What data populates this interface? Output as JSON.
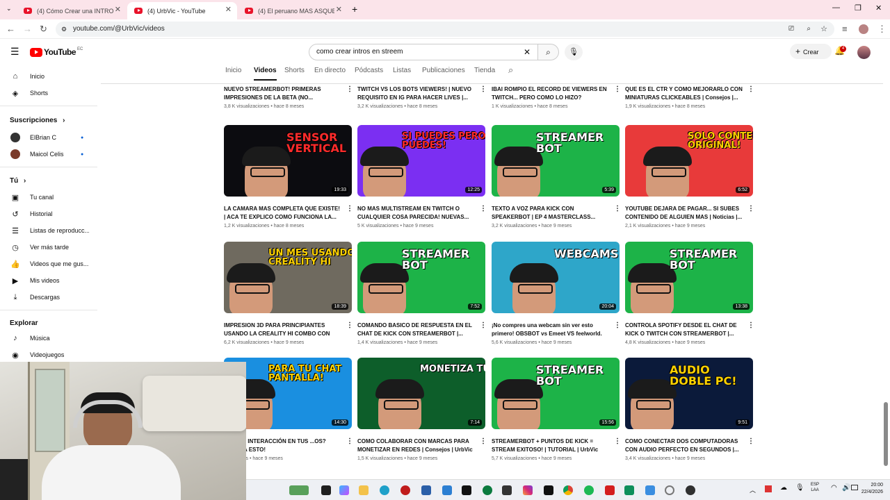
{
  "browser": {
    "tabs": [
      {
        "title": "(4) Cómo Crear una INTRO Pro..."
      },
      {
        "title": "(4) UrbVic - YouTube"
      },
      {
        "title": "(4) El peruano MAS ASQUEROS..."
      }
    ],
    "url": "youtube.com/@UrbVic/videos"
  },
  "yt": {
    "logo_text": "YouTube",
    "region": "EC",
    "search_value": "como crear intros en streem",
    "create_label": "Crear",
    "notif_count": "4"
  },
  "sidebar": {
    "items": [
      {
        "label": "Inicio",
        "icon": "home-icon"
      },
      {
        "label": "Shorts",
        "icon": "shorts-icon"
      }
    ],
    "subs_heading": "Suscripciones",
    "subs": [
      {
        "label": "ElBrian C"
      },
      {
        "label": "Maicol Celis"
      }
    ],
    "you_heading": "Tú",
    "you_items": [
      {
        "label": "Tu canal",
        "icon": "user-icon"
      },
      {
        "label": "Historial",
        "icon": "history-icon"
      },
      {
        "label": "Listas de reproducc...",
        "icon": "playlist-icon"
      },
      {
        "label": "Ver más tarde",
        "icon": "clock-icon"
      },
      {
        "label": "Videos que me gus...",
        "icon": "thumbs-up-icon"
      },
      {
        "label": "Mis videos",
        "icon": "video-icon"
      },
      {
        "label": "Descargas",
        "icon": "download-icon"
      }
    ],
    "explore_heading": "Explorar",
    "explore_items": [
      {
        "label": "Música",
        "icon": "music-icon"
      },
      {
        "label": "Videojuegos",
        "icon": "gamepad-icon"
      }
    ]
  },
  "channel_tabs": [
    "Inicio",
    "Videos",
    "Shorts",
    "En directo",
    "Pódcasts",
    "Listas",
    "Publicaciones",
    "Tienda"
  ],
  "prev_row": [
    {
      "title": "NUEVO STREAMERBOT! PRIMERAS IMPRESIONES DE LA BETA (NO...",
      "meta": "3,8 K visualizaciones  •  hace 8 meses"
    },
    {
      "title": "TWITCH VS LOS BOTS VIEWERS! | NUEVO REQUISITO EN IG PARA HACER LIVES |...",
      "meta": "3,2 K visualizaciones  •  hace 8 meses"
    },
    {
      "title": "IBAI ROMPIO EL RECORD DE VIEWERS EN TWITCH... PERO COMO LO HIZO? CREAND...",
      "meta": "1 K visualizaciones  •  hace 8 meses"
    },
    {
      "title": "QUE ES EL CTR Y COMO MEJORARLO CON MINIATURAS CLICKEABLES | Consejos |...",
      "meta": "1,9 K visualizaciones  •  hace 8 meses"
    }
  ],
  "videos": [
    {
      "thumb_text": "SENSOR VERTICAL",
      "bg": "#0c0c10",
      "accent": "#ff2b2b",
      "duration": "19:33",
      "title": "LA CAMARA MAS COMPLETA QUE EXISTE! | ACA TE EXPLICO COMO FUNCIONA LA...",
      "meta": "1,2 K visualizaciones  •  hace 8 meses"
    },
    {
      "thumb_text": "SI PUEDES PERO NO PUEDES!",
      "bg": "#7b2ff2",
      "accent": "#ff2b2b",
      "duration": "12:25",
      "title": "NO MAS MULTISTREAM EN TWITCH O CUALQUIER COSA PARECIDA! NUEVAS...",
      "meta": "5 K visualizaciones  •  hace 9 meses"
    },
    {
      "thumb_text": "STREAMER BOT",
      "bg": "#1db348",
      "accent": "#000000",
      "duration": "5:39",
      "title": "TEXTO A VOZ PARA KICK CON SPEAKERBOT | EP 4 MASTERCLASS...",
      "meta": "3,2 K visualizaciones  •  hace 9 meses"
    },
    {
      "thumb_text": "SOLO CONTENIDO ORIGINAL!",
      "bg": "#e83a3a",
      "accent": "#ffd200",
      "duration": "6:52",
      "title": "YOUTUBE DEJARA DE PAGAR... SI SUBES CONTENIDO DE ALGUIEN MAS | Noticias |...",
      "meta": "2,1 K visualizaciones  •  hace 9 meses"
    },
    {
      "thumb_text": "UN MES USANDO LA CREALITY HI",
      "bg": "#6f6a5f",
      "accent": "#ffd200",
      "duration": "18:39",
      "title": "IMPRESION 3D PARA PRINCIPIANTES USANDO LA CREALITY HI COMBO CON CF...",
      "meta": "6,2 K visualizaciones  •  hace 9 meses"
    },
    {
      "thumb_text": "STREAMER BOT",
      "bg": "#1db348",
      "accent": "#000000",
      "duration": "7:52",
      "title": "COMANDO BASICO DE RESPUESTA EN EL CHAT DE KICK CON STREAMERBOT |...",
      "meta": "1,4 K visualizaciones  •  hace 9 meses"
    },
    {
      "thumb_text": "WEBCAMS",
      "bg": "#2ea6c9",
      "accent": "#ffffff",
      "duration": "20:04",
      "title": "¡No compres una webcam sin ver esto primero! OBSBOT vs Emeet VS feelworld.",
      "meta": "5,6 K visualizaciones  •  hace 9 meses"
    },
    {
      "thumb_text": "STREAMER BOT",
      "bg": "#1db348",
      "accent": "#000000",
      "duration": "13:38",
      "title": "CONTROLA SPOTIFY DESDE EL CHAT DE KICK O TWITCH CON STREAMERBOT |...",
      "meta": "4,8 K visualizaciones  •  hace 9 meses"
    },
    {
      "thumb_text": "PARA TU CHAT PANTALLA!",
      "bg": "#1a8fe0",
      "accent": "#ffd200",
      "duration": "14:30",
      "title": "...S MÁS INTERACCIÓN EN TUS ...OS? PRUEBA ESTO!",
      "meta": "...izaciones  •  hace 9 meses"
    },
    {
      "thumb_text": "MONETIZA TUS REDES",
      "bg": "#0d5e2a",
      "accent": "#ffffff",
      "duration": "7:14",
      "title": "COMO COLABORAR CON MARCAS PARA MONETIZAR EN REDES | Consejos | UrbVic",
      "meta": "1,5 K visualizaciones  •  hace 9 meses"
    },
    {
      "thumb_text": "STREAMER BOT",
      "bg": "#1db348",
      "accent": "#000000",
      "duration": "15:56",
      "title": "STREAMERBOT + PUNTOS DE KICK = STREAM EXITOSO! | TUTORIAL | UrbVic",
      "meta": "5,7 K visualizaciones  •  hace 9 meses"
    },
    {
      "thumb_text": "AUDIO DOBLE PC!",
      "bg": "#0b1a3a",
      "accent": "#ffd200",
      "duration": "9:51",
      "title": "COMO CONECTAR DOS COMPUTADORAS CON AUDIO PERFECTO EN SEGUNDOS |...",
      "meta": "3,4 K visualizaciones  •  hace 9 meses"
    }
  ],
  "taskbar": {
    "lang": "ESP",
    "lang2": "LAA",
    "time": "20:00",
    "date": "22/4/2026"
  }
}
